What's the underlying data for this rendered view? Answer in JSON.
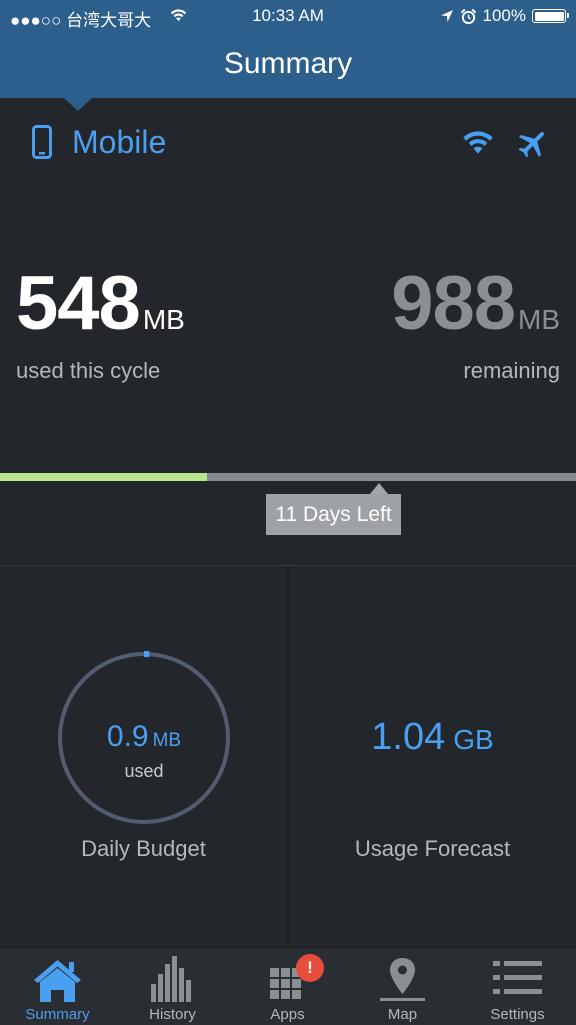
{
  "status_bar": {
    "carrier": "●●●○○ 台湾大哥大",
    "time": "10:33 AM",
    "battery": "100%",
    "icons": [
      "wifi-icon",
      "location-arrow-icon",
      "alarm-icon",
      "battery-icon"
    ]
  },
  "nav": {
    "title": "Summary"
  },
  "connection": {
    "label": "Mobile",
    "icons": [
      "phone-icon",
      "wifi-icon",
      "airplane-icon"
    ]
  },
  "usage": {
    "used_value": "548",
    "used_unit": "MB",
    "used_label": "used this cycle",
    "remaining_value": "988",
    "remaining_unit": "MB",
    "remaining_label": "remaining",
    "progress_fraction": 0.36,
    "days_left": "11 Days Left"
  },
  "daily_budget": {
    "value": "0.9",
    "unit": "MB",
    "sub": "used",
    "label": "Daily Budget",
    "fraction": 0.01
  },
  "forecast": {
    "value": "1.04",
    "unit": "GB",
    "label": "Usage Forecast"
  },
  "tabs": [
    {
      "label": "Summary",
      "icon": "home-icon",
      "active": true
    },
    {
      "label": "History",
      "icon": "bar-chart-icon"
    },
    {
      "label": "Apps",
      "icon": "grid-icon"
    },
    {
      "label": "Map",
      "icon": "map-pin-icon"
    },
    {
      "label": "Settings",
      "icon": "list-icon"
    }
  ],
  "apps_badge": "!",
  "colors": {
    "accent": "#4a9ff0",
    "nav_bar": "#2d5f8c",
    "background": "#23272b",
    "progress": "#b6e58a",
    "badge": "#e74c3c"
  }
}
